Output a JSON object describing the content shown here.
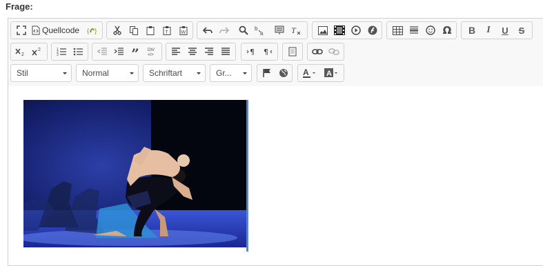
{
  "field_label": "Frage:",
  "toolbar": {
    "source_label": "Quellcode",
    "style_combo": "Stil",
    "format_combo": "Normal",
    "font_combo": "Schriftart",
    "size_combo": "Gr..."
  },
  "colors": {
    "accent_border": "#3b8ee3",
    "toolbar_bg": "#f8f8f8",
    "icon": "#474747"
  },
  "content": {
    "image_alt": "Ballet dancers on a blue-lit stage"
  }
}
